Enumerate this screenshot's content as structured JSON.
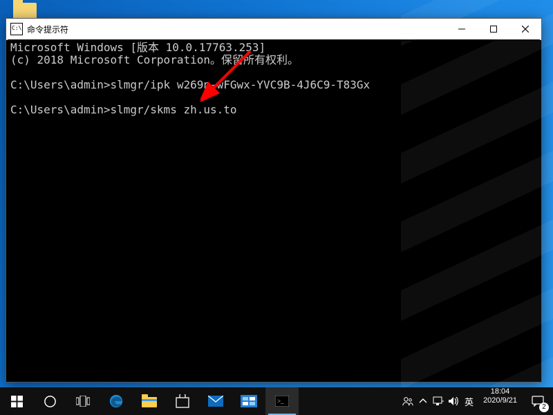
{
  "window": {
    "title": "命令提示符"
  },
  "terminal": {
    "lines": [
      "Microsoft Windows [版本 10.0.17763.253]",
      "(c) 2018 Microsoft Corporation。保留所有权利。",
      "",
      "C:\\Users\\admin>slmgr/ipk w269n-wFGwx-YVC9B-4J6C9-T83Gx",
      "",
      "C:\\Users\\admin>slmgr/skms zh.us.to",
      ""
    ]
  },
  "taskbar": {
    "ime": "英",
    "time": "18:04",
    "date": "2020/9/21",
    "notif_count": "2"
  }
}
